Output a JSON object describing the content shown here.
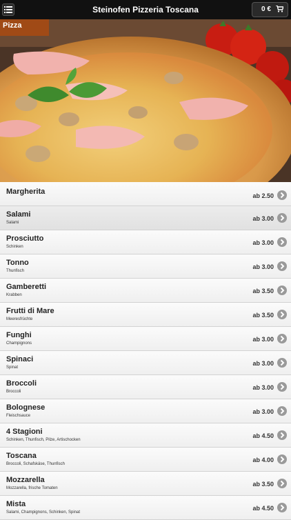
{
  "header": {
    "title": "Steinofen Pizzeria Toscana",
    "cart_total": "0 €",
    "menu_icon": "list-icon",
    "cart_icon": "shopping-cart-icon"
  },
  "category": {
    "label": "Pizza"
  },
  "items": [
    {
      "name": "Margherita",
      "desc": "",
      "price": "ab 2.50"
    },
    {
      "name": "Salami",
      "desc": "Salami",
      "price": "ab 3.00"
    },
    {
      "name": "Prosciutto",
      "desc": "Schinken",
      "price": "ab 3.00"
    },
    {
      "name": "Tonno",
      "desc": "Thunfisch",
      "price": "ab 3.00"
    },
    {
      "name": "Gamberetti",
      "desc": "Krabben",
      "price": "ab 3.50"
    },
    {
      "name": "Frutti di Mare",
      "desc": "Meeresfrüchte",
      "price": "ab 3.50"
    },
    {
      "name": "Funghi",
      "desc": "Champignons",
      "price": "ab 3.00"
    },
    {
      "name": "Spinaci",
      "desc": "Spinat",
      "price": "ab 3.00"
    },
    {
      "name": "Broccoli",
      "desc": "Broccoli",
      "price": "ab 3.00"
    },
    {
      "name": "Bolognese",
      "desc": "Fleischsauce",
      "price": "ab 3.00"
    },
    {
      "name": "4 Stagioni",
      "desc": "Schinken, Thunfisch, Pilze, Artischocken",
      "price": "ab 4.50"
    },
    {
      "name": "Toscana",
      "desc": "Broccoli, Schafskäse, Thunfisch",
      "price": "ab 4.00"
    },
    {
      "name": "Mozzarella",
      "desc": "Mozzarella, frische Tomaten",
      "price": "ab 3.50"
    },
    {
      "name": "Mista",
      "desc": "Salami, Champignons, Schinken, Spinat",
      "price": "ab 4.50"
    }
  ],
  "colors": {
    "topbar": "#111111",
    "category_label": "#a04a16",
    "arrow": "#9a9a9a"
  }
}
